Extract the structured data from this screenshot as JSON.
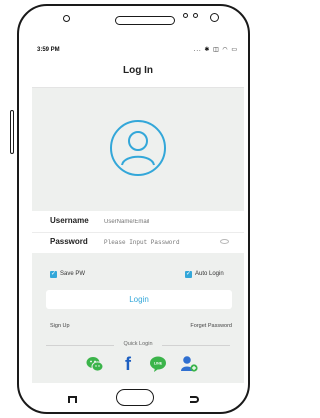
{
  "status": {
    "time": "3:59 PM",
    "icons": "... ✱ ◫ ◠ ▭"
  },
  "header": {
    "title": "Log In"
  },
  "form": {
    "username_label": "Username",
    "username_placeholder": "UserName/Email",
    "password_label": "Password",
    "password_placeholder": "Please Input Password"
  },
  "options": {
    "save_pw": "Save PW",
    "auto_login": "Auto Login",
    "save_pw_checked": true,
    "auto_login_checked": true
  },
  "actions": {
    "login": "Login",
    "signup": "Sign Up",
    "forgot": "Forget Password"
  },
  "quick_login": {
    "label": "Quick Login",
    "facebook_glyph": "f",
    "line_text": "LINE"
  },
  "colors": {
    "accent": "#33a7d9",
    "wechat": "#3bb44a",
    "facebook": "#1d5fc1",
    "line": "#3bb44a",
    "add_contact": "#2f6fd0"
  }
}
